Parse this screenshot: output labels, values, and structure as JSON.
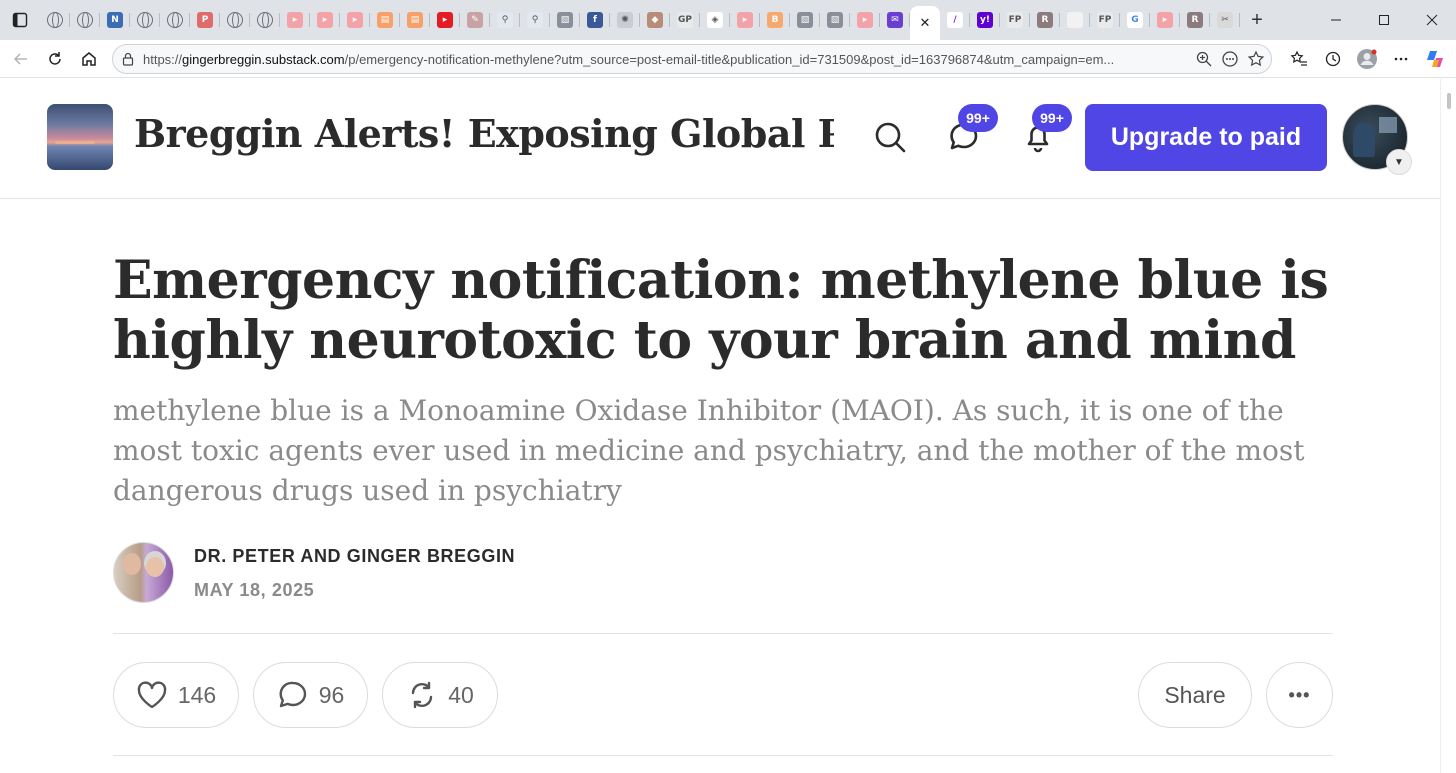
{
  "browser": {
    "url_host": "gingerbreggin.substack.com",
    "url_prefix": "https://",
    "url_rest": "/p/emergency-notification-methylene?utm_source=post-email-title&publication_id=731509&post_id=163796874&utm_campaign=em...",
    "close_tab_glyph": "✕",
    "new_tab_glyph": "+",
    "tab_favicons": [
      "globe",
      "globe",
      "news",
      "globe",
      "globe",
      "pdf",
      "globe",
      "globe",
      "youtube-pink",
      "youtube-pink",
      "youtube-pink",
      "substack",
      "substack",
      "youtube",
      "bird",
      "search",
      "search",
      "image",
      "facebook",
      "seal",
      "art",
      "gp",
      "diamond",
      "youtube-pink",
      "blogger",
      "image",
      "image",
      "youtube-pink",
      "mail",
      "active",
      "yahoo-slash",
      "yahoo",
      "fp",
      "rumble-r",
      "blank",
      "fp",
      "google",
      "youtube-pink",
      "rumble-r",
      "wrench"
    ],
    "accent_colors": {
      "youtube": "#e31b23",
      "yahoo": "#5f01d1",
      "substack": "#ff6719"
    }
  },
  "site": {
    "publication_title": "Breggin Alerts! Exposing Global Pr...",
    "notifications_badge": "99+",
    "messages_badge": "99+",
    "upgrade_label": "Upgrade to paid",
    "accent_color": "#5046e5"
  },
  "post": {
    "title": "Emergency notification: methylene blue is highly neurotoxic to your brain and mind",
    "subtitle": "methylene blue is a Monoamine Oxidase Inhibitor (MAOI). As such, it is one of the most toxic agents ever used in medicine and psychiatry, and the mother of the most dangerous drugs used in psychiatry",
    "author": "DR. PETER AND GINGER BREGGIN",
    "date": "MAY 18, 2025"
  },
  "actions": {
    "likes": "146",
    "comments": "96",
    "restacks": "40",
    "share_label": "Share",
    "more_label": "•••"
  }
}
